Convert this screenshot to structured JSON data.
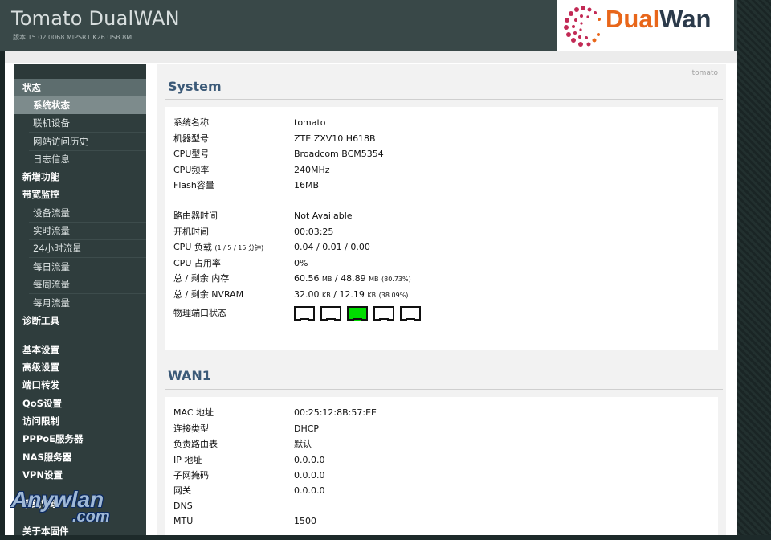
{
  "header": {
    "title": "Tomato DualWAN",
    "version": "版本 15.02.0068 MIPSR1 K26 USB 8M",
    "logo_dual": "Dual",
    "logo_wan": "Wan"
  },
  "sidebar": {
    "items": [
      {
        "label": "状态"
      },
      {
        "label": "系统状态"
      },
      {
        "label": "联机设备"
      },
      {
        "label": "网站访问历史"
      },
      {
        "label": "日志信息"
      },
      {
        "label": "新增功能"
      },
      {
        "label": "带宽监控"
      },
      {
        "label": "设备流量"
      },
      {
        "label": "实时流量"
      },
      {
        "label": "24小时流量"
      },
      {
        "label": "每日流量"
      },
      {
        "label": "每周流量"
      },
      {
        "label": "每月流量"
      },
      {
        "label": "诊断工具"
      },
      {
        "label": "基本设置"
      },
      {
        "label": "高级设置"
      },
      {
        "label": "端口转发"
      },
      {
        "label": "QoS设置"
      },
      {
        "label": "访问限制"
      },
      {
        "label": "PPPoE服务器"
      },
      {
        "label": "NAS服务器"
      },
      {
        "label": "VPN设置"
      },
      {
        "label": "系统管理"
      },
      {
        "label": "关于本固件"
      }
    ]
  },
  "watermark": {
    "text": "Anywlan",
    "suffix": ".com"
  },
  "main": {
    "router_name": "tomato",
    "system": {
      "title": "System",
      "rows": [
        {
          "k": "系统名称",
          "v": "tomato"
        },
        {
          "k": "机器型号",
          "v": "ZTE ZXV10 H618B"
        },
        {
          "k": "CPU型号",
          "v": "Broadcom BCM5354"
        },
        {
          "k": "CPU频率",
          "v": "240MHz"
        },
        {
          "k": "Flash容量",
          "v": "16MB"
        },
        {
          "k": "路由器时间",
          "v": "Not Available"
        },
        {
          "k": "开机时间",
          "v": "00:03:25"
        },
        {
          "k": "CPU 负载",
          "k_small": "(1 / 5 / 15 分钟)",
          "v": "0.04 / 0.01 / 0.00"
        },
        {
          "k": "CPU 占用率",
          "v": "0%"
        },
        {
          "k": "总 / 剩余 内存",
          "v1": "60.56",
          "u1": "MB",
          "sep": " / ",
          "v2": "48.89",
          "u2": "MB",
          "pct": "(80.73%)"
        },
        {
          "k": "总 / 剩余 NVRAM",
          "v1": "32.00",
          "u1": "KB",
          "sep": " / ",
          "v2": "12.19",
          "u2": "KB",
          "pct": "(38.09%)"
        },
        {
          "k": "物理端口状态"
        }
      ],
      "ports": [
        {
          "name": "port-1",
          "link": false
        },
        {
          "name": "port-2",
          "link": false
        },
        {
          "name": "port-3",
          "link": true
        },
        {
          "name": "port-4",
          "link": false
        },
        {
          "name": "port-5",
          "link": false
        }
      ]
    },
    "wan1": {
      "title": "WAN1",
      "rows": [
        {
          "k": "MAC 地址",
          "v": "00:25:12:8B:57:EE"
        },
        {
          "k": "连接类型",
          "v": "DHCP"
        },
        {
          "k": "负责路由表",
          "v": "默认"
        },
        {
          "k": "IP 地址",
          "v": "0.0.0.0"
        },
        {
          "k": "子网掩码",
          "v": "0.0.0.0"
        },
        {
          "k": "网关",
          "v": "0.0.0.0"
        },
        {
          "k": "DNS",
          "v": ""
        },
        {
          "k": "MTU",
          "v": "1500"
        }
      ]
    }
  },
  "colors": {
    "header_bg": "#394848",
    "sidebar_bg": "#2f3d3d",
    "section_title": "#3c5a78",
    "port_up": "#00dd00"
  }
}
